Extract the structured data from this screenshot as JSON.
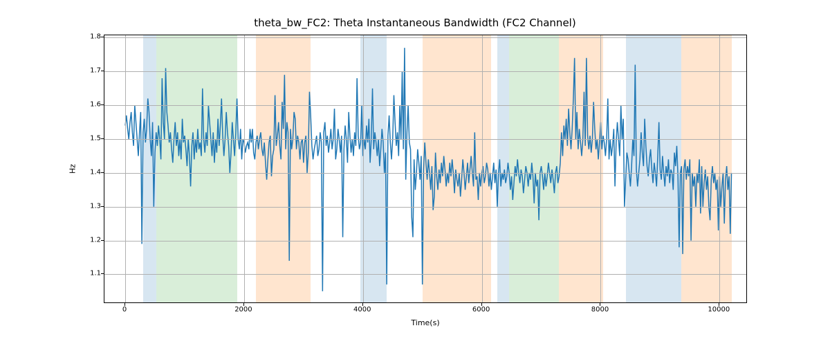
{
  "chart_data": {
    "type": "line",
    "title": "theta_bw_FC2: Theta Instantaneous Bandwidth (FC2 Channel)",
    "xlabel": "Time(s)",
    "ylabel": "Hz",
    "xlim": [
      -350,
      10450
    ],
    "ylim": [
      1.017,
      1.807
    ],
    "xticks": [
      0,
      2000,
      4000,
      6000,
      8000,
      10000
    ],
    "yticks": [
      1.1,
      1.2,
      1.3,
      1.4,
      1.5,
      1.6,
      1.7,
      1.8
    ],
    "bands": [
      {
        "color": "blue",
        "x0": 300,
        "x1": 520
      },
      {
        "color": "green",
        "x0": 520,
        "x1": 1880
      },
      {
        "color": "orange",
        "x0": 2200,
        "x1": 3120
      },
      {
        "color": "blue",
        "x0": 3960,
        "x1": 4400
      },
      {
        "color": "orange",
        "x0": 5000,
        "x1": 6160
      },
      {
        "color": "blue",
        "x0": 6260,
        "x1": 6460
      },
      {
        "color": "green",
        "x0": 6460,
        "x1": 7300
      },
      {
        "color": "orange",
        "x0": 7300,
        "x1": 8040
      },
      {
        "color": "blue",
        "x0": 8420,
        "x1": 9360
      },
      {
        "color": "orange",
        "x0": 9360,
        "x1": 10200
      }
    ],
    "series": [
      {
        "name": "theta_bw_FC2",
        "x_start": 0,
        "x_step": 20,
        "values": [
          1.54,
          1.57,
          1.53,
          1.5,
          1.55,
          1.58,
          1.52,
          1.48,
          1.6,
          1.55,
          1.5,
          1.45,
          1.52,
          1.58,
          1.19,
          1.52,
          1.56,
          1.49,
          1.53,
          1.62,
          1.58,
          1.5,
          1.45,
          1.55,
          1.3,
          1.46,
          1.52,
          1.48,
          1.54,
          1.5,
          1.44,
          1.68,
          1.55,
          1.5,
          1.71,
          1.58,
          1.54,
          1.49,
          1.52,
          1.47,
          1.43,
          1.5,
          1.55,
          1.48,
          1.52,
          1.45,
          1.5,
          1.44,
          1.56,
          1.49,
          1.51,
          1.47,
          1.42,
          1.5,
          1.45,
          1.36,
          1.48,
          1.52,
          1.44,
          1.5,
          1.46,
          1.53,
          1.47,
          1.49,
          1.45,
          1.65,
          1.5,
          1.46,
          1.52,
          1.48,
          1.6,
          1.55,
          1.5,
          1.45,
          1.52,
          1.43,
          1.5,
          1.46,
          1.56,
          1.48,
          1.54,
          1.62,
          1.51,
          1.45,
          1.5,
          1.58,
          1.52,
          1.48,
          1.4,
          1.46,
          1.55,
          1.5,
          1.45,
          1.52,
          1.62,
          1.5,
          1.47,
          1.53,
          1.44,
          1.5,
          1.49,
          1.46,
          1.48,
          1.49,
          1.47,
          1.53,
          1.49,
          1.53,
          1.46,
          1.44,
          1.49,
          1.51,
          1.47,
          1.5,
          1.52,
          1.47,
          1.45,
          1.49,
          1.43,
          1.38,
          1.44,
          1.49,
          1.51,
          1.39,
          1.45,
          1.47,
          1.63,
          1.48,
          1.51,
          1.55,
          1.48,
          1.44,
          1.61,
          1.53,
          1.69,
          1.47,
          1.55,
          1.52,
          1.14,
          1.53,
          1.47,
          1.5,
          1.58,
          1.56,
          1.47,
          1.51,
          1.49,
          1.44,
          1.49,
          1.5,
          1.43,
          1.49,
          1.51,
          1.4,
          1.46,
          1.64,
          1.57,
          1.48,
          1.44,
          1.47,
          1.49,
          1.51,
          1.45,
          1.47,
          1.52,
          1.49,
          1.05,
          1.52,
          1.55,
          1.48,
          1.51,
          1.46,
          1.49,
          1.53,
          1.47,
          1.5,
          1.59,
          1.44,
          1.47,
          1.53,
          1.5,
          1.46,
          1.51,
          1.21,
          1.47,
          1.54,
          1.5,
          1.43,
          1.58,
          1.51,
          1.46,
          1.5,
          1.45,
          1.52,
          1.48,
          1.68,
          1.51,
          1.47,
          1.49,
          1.6,
          1.45,
          1.5,
          1.47,
          1.54,
          1.49,
          1.56,
          1.43,
          1.5,
          1.65,
          1.47,
          1.52,
          1.49,
          1.45,
          1.5,
          1.42,
          1.47,
          1.53,
          1.49,
          1.4,
          1.46,
          1.07,
          1.51,
          1.57,
          1.49,
          1.44,
          1.5,
          1.63,
          1.55,
          1.48,
          1.52,
          1.45,
          1.6,
          1.5,
          1.7,
          1.47,
          1.77,
          1.38,
          1.52,
          1.6,
          1.49,
          1.47,
          1.27,
          1.21,
          1.44,
          1.35,
          1.4,
          1.47,
          1.43,
          1.38,
          1.45,
          1.07,
          1.41,
          1.49,
          1.43,
          1.38,
          1.44,
          1.4,
          1.35,
          1.42,
          1.29,
          1.33,
          1.46,
          1.39,
          1.35,
          1.41,
          1.37,
          1.43,
          1.39,
          1.45,
          1.41,
          1.36,
          1.4,
          1.37,
          1.43,
          1.39,
          1.44,
          1.4,
          1.34,
          1.41,
          1.38,
          1.36,
          1.4,
          1.33,
          1.38,
          1.44,
          1.4,
          1.35,
          1.39,
          1.43,
          1.37,
          1.41,
          1.45,
          1.4,
          1.36,
          1.52,
          1.38,
          1.39,
          1.32,
          1.4,
          1.36,
          1.4,
          1.42,
          1.37,
          1.39,
          1.43,
          1.41,
          1.36,
          1.4,
          1.35,
          1.39,
          1.43,
          1.37,
          1.41,
          1.3,
          1.4,
          1.44,
          1.36,
          1.4,
          1.38,
          1.41,
          1.37,
          1.39,
          1.43,
          1.4,
          1.35,
          1.39,
          1.32,
          1.37,
          1.42,
          1.39,
          1.44,
          1.4,
          1.37,
          1.41,
          1.39,
          1.34,
          1.38,
          1.42,
          1.4,
          1.36,
          1.4,
          1.38,
          1.43,
          1.39,
          1.31,
          1.4,
          1.36,
          1.38,
          1.26,
          1.4,
          1.42,
          1.39,
          1.35,
          1.4,
          1.36,
          1.39,
          1.43,
          1.4,
          1.37,
          1.41,
          1.38,
          1.34,
          1.4,
          1.42,
          1.37,
          1.39,
          1.43,
          1.52,
          1.45,
          1.54,
          1.5,
          1.56,
          1.48,
          1.59,
          1.52,
          1.47,
          1.53,
          1.62,
          1.74,
          1.5,
          1.58,
          1.47,
          1.53,
          1.49,
          1.45,
          1.5,
          1.64,
          1.48,
          1.74,
          1.51,
          1.47,
          1.51,
          1.46,
          1.5,
          1.61,
          1.53,
          1.47,
          1.5,
          1.44,
          1.49,
          1.55,
          1.47,
          1.51,
          1.49,
          1.45,
          1.5,
          1.62,
          1.44,
          1.5,
          1.45,
          1.48,
          1.53,
          1.36,
          1.49,
          1.55,
          1.5,
          1.45,
          1.6,
          1.5,
          1.56,
          1.3,
          1.38,
          1.46,
          1.44,
          1.4,
          1.36,
          1.42,
          1.5,
          1.45,
          1.72,
          1.41,
          1.36,
          1.4,
          1.44,
          1.52,
          1.46,
          1.42,
          1.56,
          1.48,
          1.42,
          1.39,
          1.44,
          1.47,
          1.41,
          1.37,
          1.43,
          1.4,
          1.36,
          1.45,
          1.55,
          1.41,
          1.38,
          1.45,
          1.4,
          1.36,
          1.42,
          1.39,
          1.44,
          1.37,
          1.41,
          1.4,
          1.35,
          1.46,
          1.42,
          1.48,
          1.39,
          1.18,
          1.4,
          1.42,
          1.16,
          1.41,
          1.44,
          1.38,
          1.42,
          1.39,
          1.44,
          1.2,
          1.4,
          1.36,
          1.39,
          1.3,
          1.4,
          1.37,
          1.44,
          1.28,
          1.42,
          1.3,
          1.37,
          1.41,
          1.35,
          1.39,
          1.3,
          1.26,
          1.38,
          1.42,
          1.37,
          1.4,
          1.35,
          1.38,
          1.23,
          1.39,
          1.3,
          1.36,
          1.4,
          1.25,
          1.38,
          1.42,
          1.35,
          1.39,
          1.22,
          1.4
        ]
      }
    ]
  }
}
